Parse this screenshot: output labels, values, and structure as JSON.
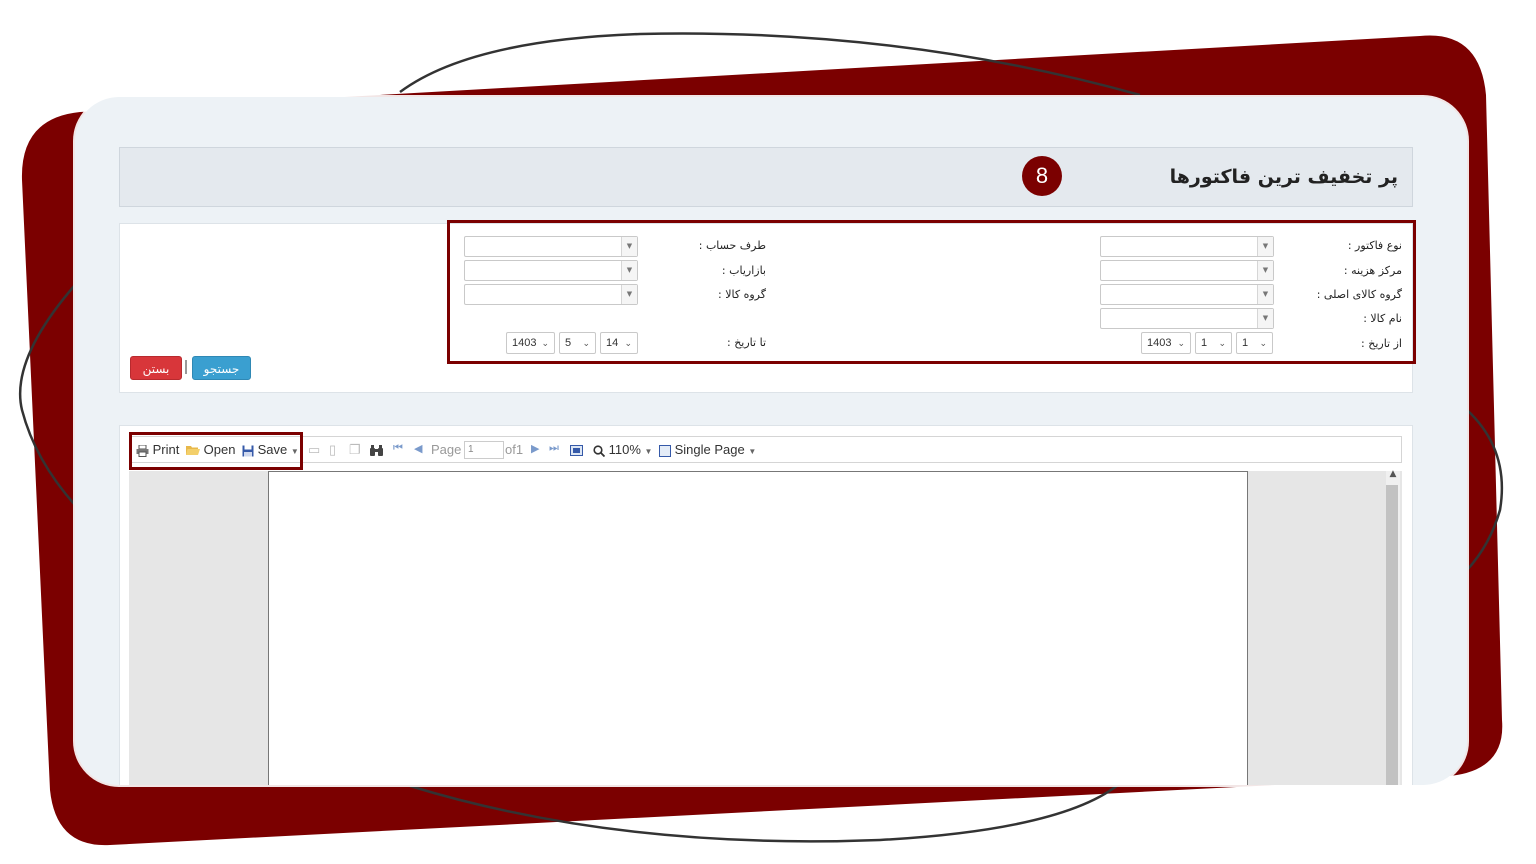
{
  "page": {
    "title": "پر تخفیف ترین فاکتورها",
    "step_badge": "8"
  },
  "filters": {
    "invoice_type_label": "نوع فاکتور :",
    "cost_center_label": "مرکز هزینه :",
    "main_goods_group_label": "گروه کالای اصلی :",
    "goods_name_label": "نام کالا :",
    "from_date_label": "از تاریخ :",
    "account_party_label": "طرف حساب :",
    "marketer_label": "بازاریاب :",
    "goods_group_label": "گروه کالا :",
    "to_date_label": "تا تاریخ :",
    "from_date": {
      "year": "1403",
      "month": "1",
      "day": "1"
    },
    "to_date": {
      "year": "1403",
      "month": "5",
      "day": "14"
    }
  },
  "actions": {
    "search_label": "جستجو",
    "close_label": "بستن"
  },
  "toolbar": {
    "print_label": "Print",
    "open_label": "Open",
    "save_label": "Save",
    "page_label": "Page",
    "page_value": "1",
    "of_label": "of1",
    "zoom_label": "110%",
    "view_mode_label": "Single Page"
  },
  "colors": {
    "accent_dark_red": "#7b0000",
    "search_blue": "#3a9fd0",
    "close_red": "#d8363a"
  }
}
